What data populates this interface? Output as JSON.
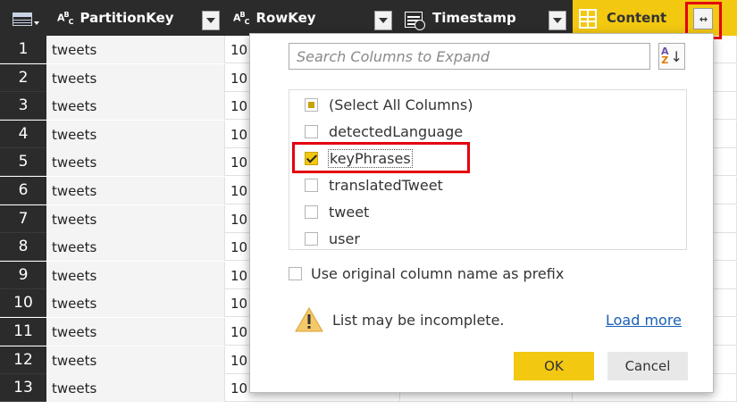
{
  "header": {
    "columns": [
      {
        "type_label": "ABC",
        "name": "PartitionKey"
      },
      {
        "type_label": "ABC",
        "name": "RowKey"
      },
      {
        "type_label": "",
        "name": "Timestamp"
      },
      {
        "type_label": "",
        "name": "Content"
      }
    ],
    "expand_icon_label": "↔"
  },
  "rows": [
    {
      "num": "1",
      "partition": "tweets",
      "rowkey": "10"
    },
    {
      "num": "2",
      "partition": "tweets",
      "rowkey": "10"
    },
    {
      "num": "3",
      "partition": "tweets",
      "rowkey": "10"
    },
    {
      "num": "4",
      "partition": "tweets",
      "rowkey": "10"
    },
    {
      "num": "5",
      "partition": "tweets",
      "rowkey": "10"
    },
    {
      "num": "6",
      "partition": "tweets",
      "rowkey": "10"
    },
    {
      "num": "7",
      "partition": "tweets",
      "rowkey": "10"
    },
    {
      "num": "8",
      "partition": "tweets",
      "rowkey": "10"
    },
    {
      "num": "9",
      "partition": "tweets",
      "rowkey": "10"
    },
    {
      "num": "10",
      "partition": "tweets",
      "rowkey": "10"
    },
    {
      "num": "11",
      "partition": "tweets",
      "rowkey": "10"
    },
    {
      "num": "12",
      "partition": "tweets",
      "rowkey": "10"
    },
    {
      "num": "13",
      "partition": "tweets",
      "rowkey": "10"
    }
  ],
  "dialog": {
    "search_placeholder": "Search Columns to Expand",
    "sort_icon": "sort-az-icon",
    "columns": [
      {
        "label": "(Select All Columns)",
        "state": "partial"
      },
      {
        "label": "detectedLanguage",
        "state": "unchecked"
      },
      {
        "label": "keyPhrases",
        "state": "checked"
      },
      {
        "label": "translatedTweet",
        "state": "unchecked"
      },
      {
        "label": "tweet",
        "state": "unchecked"
      },
      {
        "label": "user",
        "state": "unchecked"
      }
    ],
    "prefix_label": "Use original column name as prefix",
    "warning_text": "List may be incomplete.",
    "load_more": "Load more",
    "ok_label": "OK",
    "cancel_label": "Cancel"
  },
  "colors": {
    "accent": "#f2c811",
    "header_bg": "#2b2b2b",
    "highlight": "#e3000f",
    "link": "#1a5fb4"
  }
}
